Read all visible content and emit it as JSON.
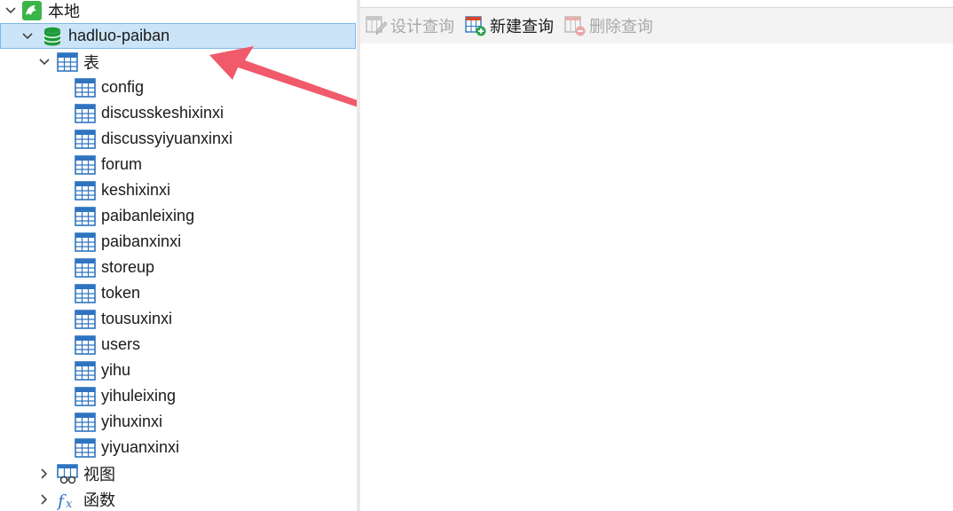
{
  "tree": {
    "connection": {
      "label": "本地",
      "icon": "navicat-dolphin-icon",
      "expanded": true
    },
    "database": {
      "label": "hadluo-paiban",
      "icon": "database-icon",
      "expanded": true,
      "selected": true
    },
    "tables_group": {
      "label": "表",
      "icon": "table-group-icon",
      "expanded": true
    },
    "tables": [
      "config",
      "discusskeshixinxi",
      "discussyiyuanxinxi",
      "forum",
      "keshixinxi",
      "paibanleixing",
      "paibanxinxi",
      "storeup",
      "token",
      "tousuxinxi",
      "users",
      "yihu",
      "yihuleixing",
      "yihuxinxi",
      "yiyuanxinxi"
    ],
    "views_group": {
      "label": "视图",
      "icon": "view-icon",
      "expanded": false
    },
    "functions_group": {
      "label": "函数",
      "icon": "function-icon",
      "expanded": false
    }
  },
  "toolbar": {
    "design_query": {
      "label": "设计查询",
      "enabled": false
    },
    "new_query": {
      "label": "新建查询",
      "enabled": true
    },
    "delete_query": {
      "label": "删除查询",
      "enabled": false
    }
  },
  "colors": {
    "selection_bg": "#cce4f7",
    "selection_border": "#7fb7e6",
    "table_icon": "#2f74c0",
    "database_icon": "#1e9b3a",
    "annotation_arrow": "#f05a6a"
  }
}
